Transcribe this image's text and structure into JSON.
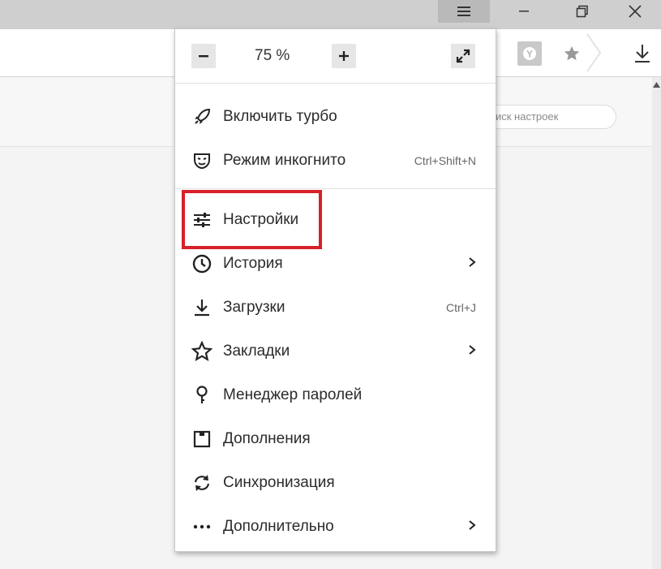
{
  "window": {
    "buttons": [
      "menu-hamburger",
      "minimize",
      "restore",
      "close"
    ]
  },
  "toolbar": {
    "icons": [
      "yandex-shield-icon",
      "star-icon",
      "download-icon"
    ]
  },
  "settings_page": {
    "search_placeholder": "иск настроек"
  },
  "menu": {
    "zoom": {
      "value": "75 %"
    },
    "items": [
      {
        "label": "Включить турбо",
        "shortcut": "",
        "submenu": false,
        "icon": "rocket-icon"
      },
      {
        "label": "Режим инкогнито",
        "shortcut": "Ctrl+Shift+N",
        "submenu": false,
        "icon": "incognito-mask-icon"
      },
      {
        "label": "Настройки",
        "shortcut": "",
        "submenu": false,
        "icon": "sliders-icon",
        "highlighted": true
      },
      {
        "label": "История",
        "shortcut": "",
        "submenu": true,
        "icon": "clock-icon"
      },
      {
        "label": "Загрузки",
        "shortcut": "Ctrl+J",
        "submenu": false,
        "icon": "download-icon"
      },
      {
        "label": "Закладки",
        "shortcut": "",
        "submenu": true,
        "icon": "star-outline-icon"
      },
      {
        "label": "Менеджер паролей",
        "shortcut": "",
        "submenu": false,
        "icon": "key-icon"
      },
      {
        "label": "Дополнения",
        "shortcut": "",
        "submenu": false,
        "icon": "extensions-icon"
      },
      {
        "label": "Синхронизация",
        "shortcut": "",
        "submenu": false,
        "icon": "sync-icon"
      },
      {
        "label": "Дополнительно",
        "shortcut": "",
        "submenu": true,
        "icon": "more-dots-icon"
      }
    ]
  },
  "colors": {
    "highlight_border": "#d6202a",
    "menu_background": "#ffffff",
    "titlebar": "#cfcfcf"
  }
}
